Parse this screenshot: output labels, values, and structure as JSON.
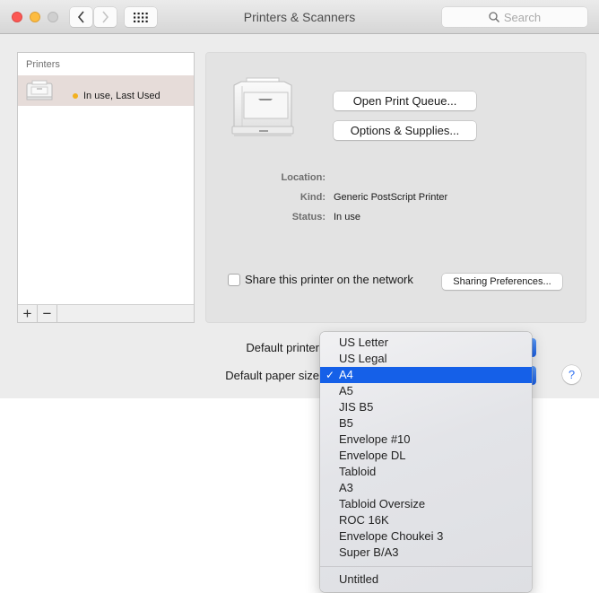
{
  "window": {
    "title": "Printers & Scanners",
    "search_placeholder": "Search"
  },
  "toolbar": {
    "back": "back",
    "forward": "forward",
    "show_all": "show-all-grid"
  },
  "printers_list": {
    "header": "Printers",
    "items": [
      {
        "status_label": "In use, Last Used",
        "status_color": "#f2b01e",
        "selected": true
      }
    ],
    "add_label": "+",
    "remove_label": "−"
  },
  "detail": {
    "open_queue_label": "Open Print Queue...",
    "options_label": "Options & Supplies...",
    "location_key": "Location:",
    "location_value": "",
    "kind_key": "Kind:",
    "kind_value": "Generic PostScript Printer",
    "status_key": "Status:",
    "status_value": "In use",
    "share_label": "Share this printer on the network",
    "share_checked": false,
    "sharing_prefs_label": "Sharing Preferences..."
  },
  "defaults": {
    "printer_label": "Default printer",
    "paper_label": "Default paper size",
    "help_label": "?"
  },
  "paper_menu": {
    "selected": "A4",
    "check": "✓",
    "items": [
      "US Letter",
      "US Legal",
      "A4",
      "A5",
      "JIS B5",
      "B5",
      "Envelope #10",
      "Envelope DL",
      "Tabloid",
      "A3",
      "Tabloid Oversize",
      "ROC 16K",
      "Envelope Choukei 3",
      "Super B/A3"
    ],
    "extra_items": [
      "Untitled"
    ]
  },
  "colors": {
    "selection": "#1560e8",
    "accent": "#2d6ff0"
  }
}
